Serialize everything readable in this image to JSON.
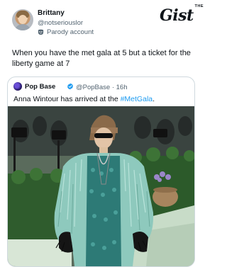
{
  "post": {
    "author_name": "Brittany",
    "author_handle": "@notseriouslor",
    "parody_label": "Parody account",
    "text": "When you have the met gala at 5 but a ticket for the liberty game at 7"
  },
  "brand": {
    "the": "THE",
    "name": "Gist"
  },
  "quote": {
    "author_name": "Pop Base",
    "meta": "@PopBase · 16h",
    "text_before": "Anna Wintour has arrived at the ",
    "hashtag": "#MetGala",
    "text_after": "."
  },
  "colors": {
    "link": "#1d9bf0",
    "verified": "#1d9bf0",
    "secondary_text": "#536471",
    "border": "#cfd9de"
  },
  "icons": {
    "parody": "parody-mask-icon",
    "verified": "verified-badge-icon"
  }
}
